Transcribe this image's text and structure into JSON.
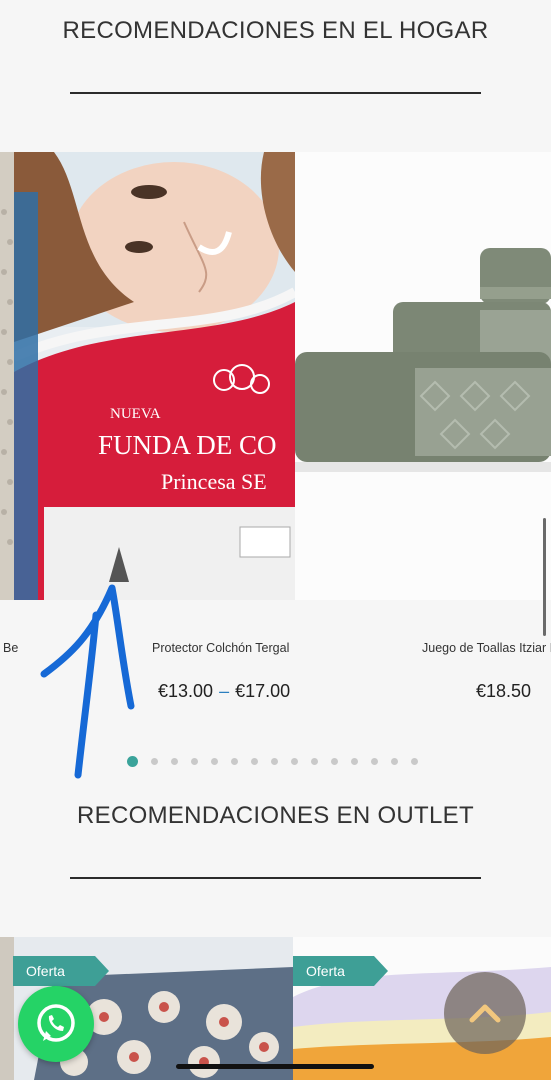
{
  "sections": {
    "home": {
      "title": "RECOMENDACIONES EN EL HOGAR"
    },
    "outlet": {
      "title": "RECOMENDACIONES EN OUTLET"
    }
  },
  "home_products": [
    {
      "name": "Be",
      "price": ""
    },
    {
      "name": "Protector Colchón Tergal",
      "price_from": "€13.00",
      "price_sep": "–",
      "price_to": "€17.00"
    },
    {
      "name": "Juego de Toallas Itziar I",
      "price": "€18.50"
    }
  ],
  "product_image_text": {
    "badge": "NUEVA",
    "headline": "FUNDA DE CO",
    "subline": "Princesa SE"
  },
  "carousel": {
    "page_count": 15,
    "active_page": 1
  },
  "outlet_products": [
    {
      "badge": "Oferta"
    },
    {
      "badge": "Oferta"
    }
  ],
  "colors": {
    "accent": "#3aa39a",
    "offer": "#3e9f96",
    "whatsapp": "#25d366",
    "annotation": "#1669d6"
  },
  "icons": {
    "whatsapp": "whatsapp-icon",
    "scroll_top": "chevron-up-icon"
  }
}
